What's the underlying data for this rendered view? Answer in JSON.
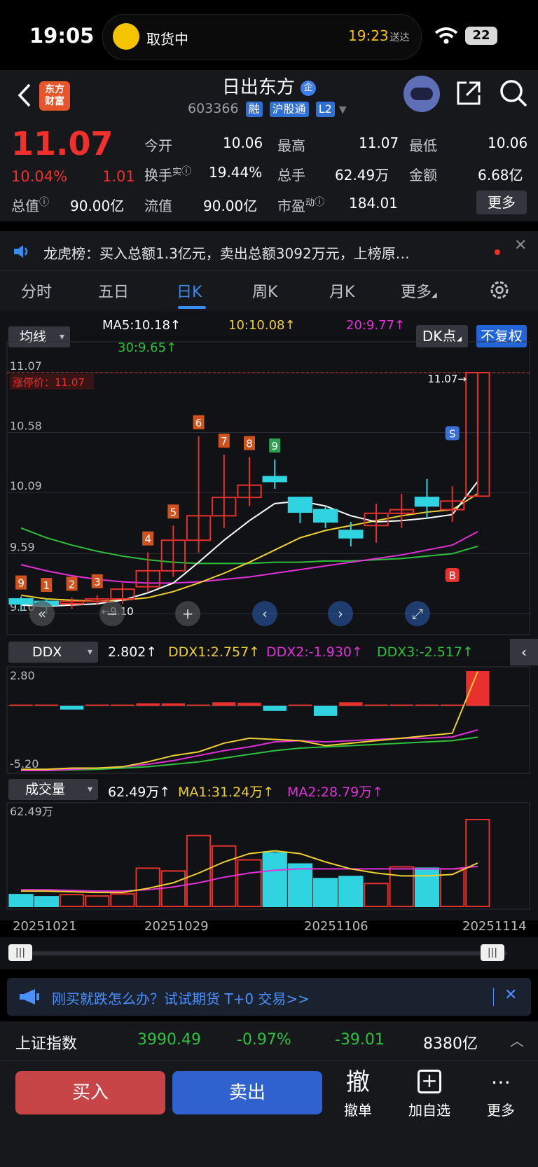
{
  "status_bar": {
    "time": "19:05",
    "pill_label": "取货中",
    "pill_eta": "19:23",
    "pill_eta_suffix": "送达",
    "battery": "22"
  },
  "header": {
    "logo_line1": "东方",
    "logo_line2": "财富",
    "name": "日出东方",
    "name_badge": "企",
    "code": "603366",
    "tags": [
      "融",
      "沪股通",
      "L2"
    ]
  },
  "quote": {
    "price": "11.07",
    "pct": "10.04%",
    "change": "1.01",
    "open_label": "今开",
    "open": "10.06",
    "high_label": "最高",
    "high": "11.07",
    "low_label": "最低",
    "low": "10.06",
    "turnover_label": "换手",
    "turnover_sup": "实",
    "turnover": "19.44%",
    "volume_label": "总手",
    "volume": "62.49万",
    "amount_label": "金额",
    "amount": "6.68亿",
    "mcap_label": "总值",
    "mcap": "90.00亿",
    "float_label": "流值",
    "float": "90.00亿",
    "pe_label": "市盈",
    "pe_sup": "动",
    "pe": "184.01",
    "more": "更多"
  },
  "ticker": {
    "text": "龙虎榜：买入总额1.3亿元，卖出总额3092万元，上榜原…"
  },
  "tabs": [
    "分时",
    "五日",
    "日K",
    "周K",
    "月K",
    "更多"
  ],
  "chart": {
    "ma_selector": "均线",
    "ma5": "MA5:10.18↑",
    "ma10": "10:10.08↑",
    "ma20": "20:9.77↑",
    "ma30": "30:9.65↑",
    "dk_button": "DK点",
    "adjust_button": "不复权",
    "limit_label": "涨停价：11.07",
    "y_labels": [
      "11.07",
      "10.58",
      "10.09",
      "9.59",
      "9.10"
    ],
    "high_mark": "11.07→",
    "low_mark": "←9.10",
    "ddx_selector": "DDX",
    "ddx": "2.802↑",
    "ddx1": "DDX1:2.757↑",
    "ddx2": "DDX2:-1.930↑",
    "ddx3": "DDX3:-2.517↑",
    "ddx_top": "2.80",
    "ddx_bottom": "-5.20",
    "vol_selector": "成交量",
    "vol": "62.49万↑",
    "vol_ma1": "MA1:31.24万↑",
    "vol_ma2": "MA2:28.79万↑",
    "vol_top": "62.49万",
    "dates": [
      "20251021",
      "20251029",
      "20251106",
      "20251114"
    ],
    "colors": {
      "up": "#e8302c",
      "down": "#2fd4e0",
      "ma5": "#ffffff",
      "ma10": "#f0d030",
      "ma20": "#e030d8",
      "ma30": "#2ec13c"
    }
  },
  "chart_data": {
    "type": "candlestick",
    "categories": [
      "1021",
      "1022",
      "1023",
      "1024",
      "1027",
      "1028",
      "1029",
      "1030",
      "1031",
      "1103",
      "1104",
      "1105",
      "1106",
      "1107",
      "1110",
      "1111",
      "1112",
      "1113",
      "1114"
    ],
    "open": [
      9.22,
      9.2,
      9.18,
      9.2,
      9.22,
      9.32,
      9.45,
      9.7,
      9.9,
      10.05,
      10.22,
      10.05,
      9.95,
      9.78,
      9.82,
      9.92,
      10.05,
      9.95,
      10.06
    ],
    "close": [
      9.18,
      9.17,
      9.2,
      9.22,
      9.3,
      9.45,
      9.7,
      9.9,
      10.05,
      10.15,
      10.18,
      9.93,
      9.85,
      9.72,
      9.92,
      9.95,
      9.98,
      10.02,
      11.07
    ],
    "high": [
      9.24,
      9.22,
      9.23,
      9.25,
      9.35,
      9.6,
      9.82,
      10.55,
      10.4,
      10.38,
      10.36,
      10.05,
      9.98,
      9.85,
      10.0,
      10.08,
      10.2,
      10.14,
      11.07
    ],
    "low": [
      9.12,
      9.1,
      9.14,
      9.17,
      9.18,
      9.28,
      9.4,
      9.6,
      9.8,
      9.98,
      10.12,
      9.84,
      9.8,
      9.65,
      9.68,
      9.8,
      9.88,
      9.85,
      10.06
    ],
    "td_counts": [
      "9",
      "1",
      "2",
      "3",
      "",
      "4",
      "5",
      "6",
      "7",
      "8",
      "9",
      "",
      "",
      "",
      "",
      "",
      "",
      "",
      ""
    ],
    "ma5": [
      9.17,
      9.16,
      9.17,
      9.18,
      9.21,
      9.27,
      9.35,
      9.52,
      9.7,
      9.86,
      10.0,
      10.02,
      9.98,
      9.9,
      9.85,
      9.86,
      9.88,
      9.91,
      10.18
    ],
    "ma10": [
      9.25,
      9.22,
      9.21,
      9.2,
      9.21,
      9.23,
      9.28,
      9.35,
      9.43,
      9.52,
      9.62,
      9.72,
      9.78,
      9.82,
      9.86,
      9.9,
      9.93,
      9.95,
      10.08
    ],
    "ma20": [
      9.5,
      9.45,
      9.41,
      9.38,
      9.36,
      9.35,
      9.35,
      9.36,
      9.38,
      9.4,
      9.43,
      9.46,
      9.49,
      9.52,
      9.55,
      9.58,
      9.62,
      9.66,
      9.77
    ],
    "ma30": [
      9.8,
      9.72,
      9.66,
      9.61,
      9.57,
      9.54,
      9.52,
      9.51,
      9.51,
      9.51,
      9.52,
      9.52,
      9.53,
      9.53,
      9.54,
      9.55,
      9.57,
      9.59,
      9.65
    ],
    "ylim": [
      9.1,
      11.07
    ],
    "signals": {
      "buy_index": 17,
      "sell_index": 17,
      "buy_label": "B",
      "sell_label": "S"
    },
    "ddx": [
      0,
      0,
      -0.3,
      0,
      0,
      0.2,
      0.2,
      0,
      0.3,
      0.25,
      -0.4,
      0,
      -0.8,
      0.3,
      0,
      0,
      0,
      0.1,
      2.802
    ],
    "ddx1": [
      -5.1,
      -5.1,
      -5.0,
      -5.0,
      -4.9,
      -4.5,
      -4.0,
      -3.7,
      -3.0,
      -2.6,
      -2.7,
      -2.8,
      -3.2,
      -3.0,
      -2.8,
      -2.6,
      -2.4,
      -2.2,
      2.757
    ],
    "ddx2": [
      -5.2,
      -5.2,
      -5.1,
      -5.0,
      -4.9,
      -4.7,
      -4.4,
      -4.0,
      -3.6,
      -3.3,
      -2.9,
      -2.8,
      -2.9,
      -2.8,
      -2.7,
      -2.6,
      -2.6,
      -2.5,
      -1.93
    ],
    "ddx3": [
      -5.2,
      -5.2,
      -5.15,
      -5.1,
      -5.0,
      -4.9,
      -4.7,
      -4.5,
      -4.2,
      -3.9,
      -3.6,
      -3.4,
      -3.3,
      -3.2,
      -3.1,
      -3.0,
      -2.9,
      -2.8,
      -2.517
    ],
    "ddx_ylim": [
      -5.2,
      2.8
    ],
    "volume": [
      8.5,
      7.0,
      8.5,
      7.5,
      9.0,
      27.5,
      25.5,
      51.0,
      43.5,
      33.5,
      38.5,
      30.5,
      20.0,
      21.5,
      16.5,
      28.5,
      27.5,
      27.0,
      62.49
    ],
    "vol_ma1": [
      11,
      11,
      10.5,
      10,
      10,
      13,
      17,
      24,
      32,
      38,
      40,
      38,
      32,
      27,
      24,
      22,
      22,
      23,
      31.24
    ],
    "vol_ma2": [
      12,
      12,
      11.5,
      11,
      11,
      12,
      14,
      17,
      21,
      24,
      26,
      27,
      27,
      27,
      27,
      27,
      27,
      27,
      28.79
    ],
    "vol_ylim": [
      0,
      62.49
    ]
  },
  "promo": {
    "text": "刚买就跌怎么办？试试期货 T+0 交易>>"
  },
  "index_bar": {
    "name": "上证指数",
    "value": "3990.49",
    "pct": "-0.97%",
    "change": "-39.01",
    "amount": "8380亿"
  },
  "bottom_bar": {
    "buy": "买入",
    "sell": "卖出",
    "cancel_icon_text": "撤",
    "cancel": "撤单",
    "add_watch": "加自选",
    "more": "更多"
  }
}
